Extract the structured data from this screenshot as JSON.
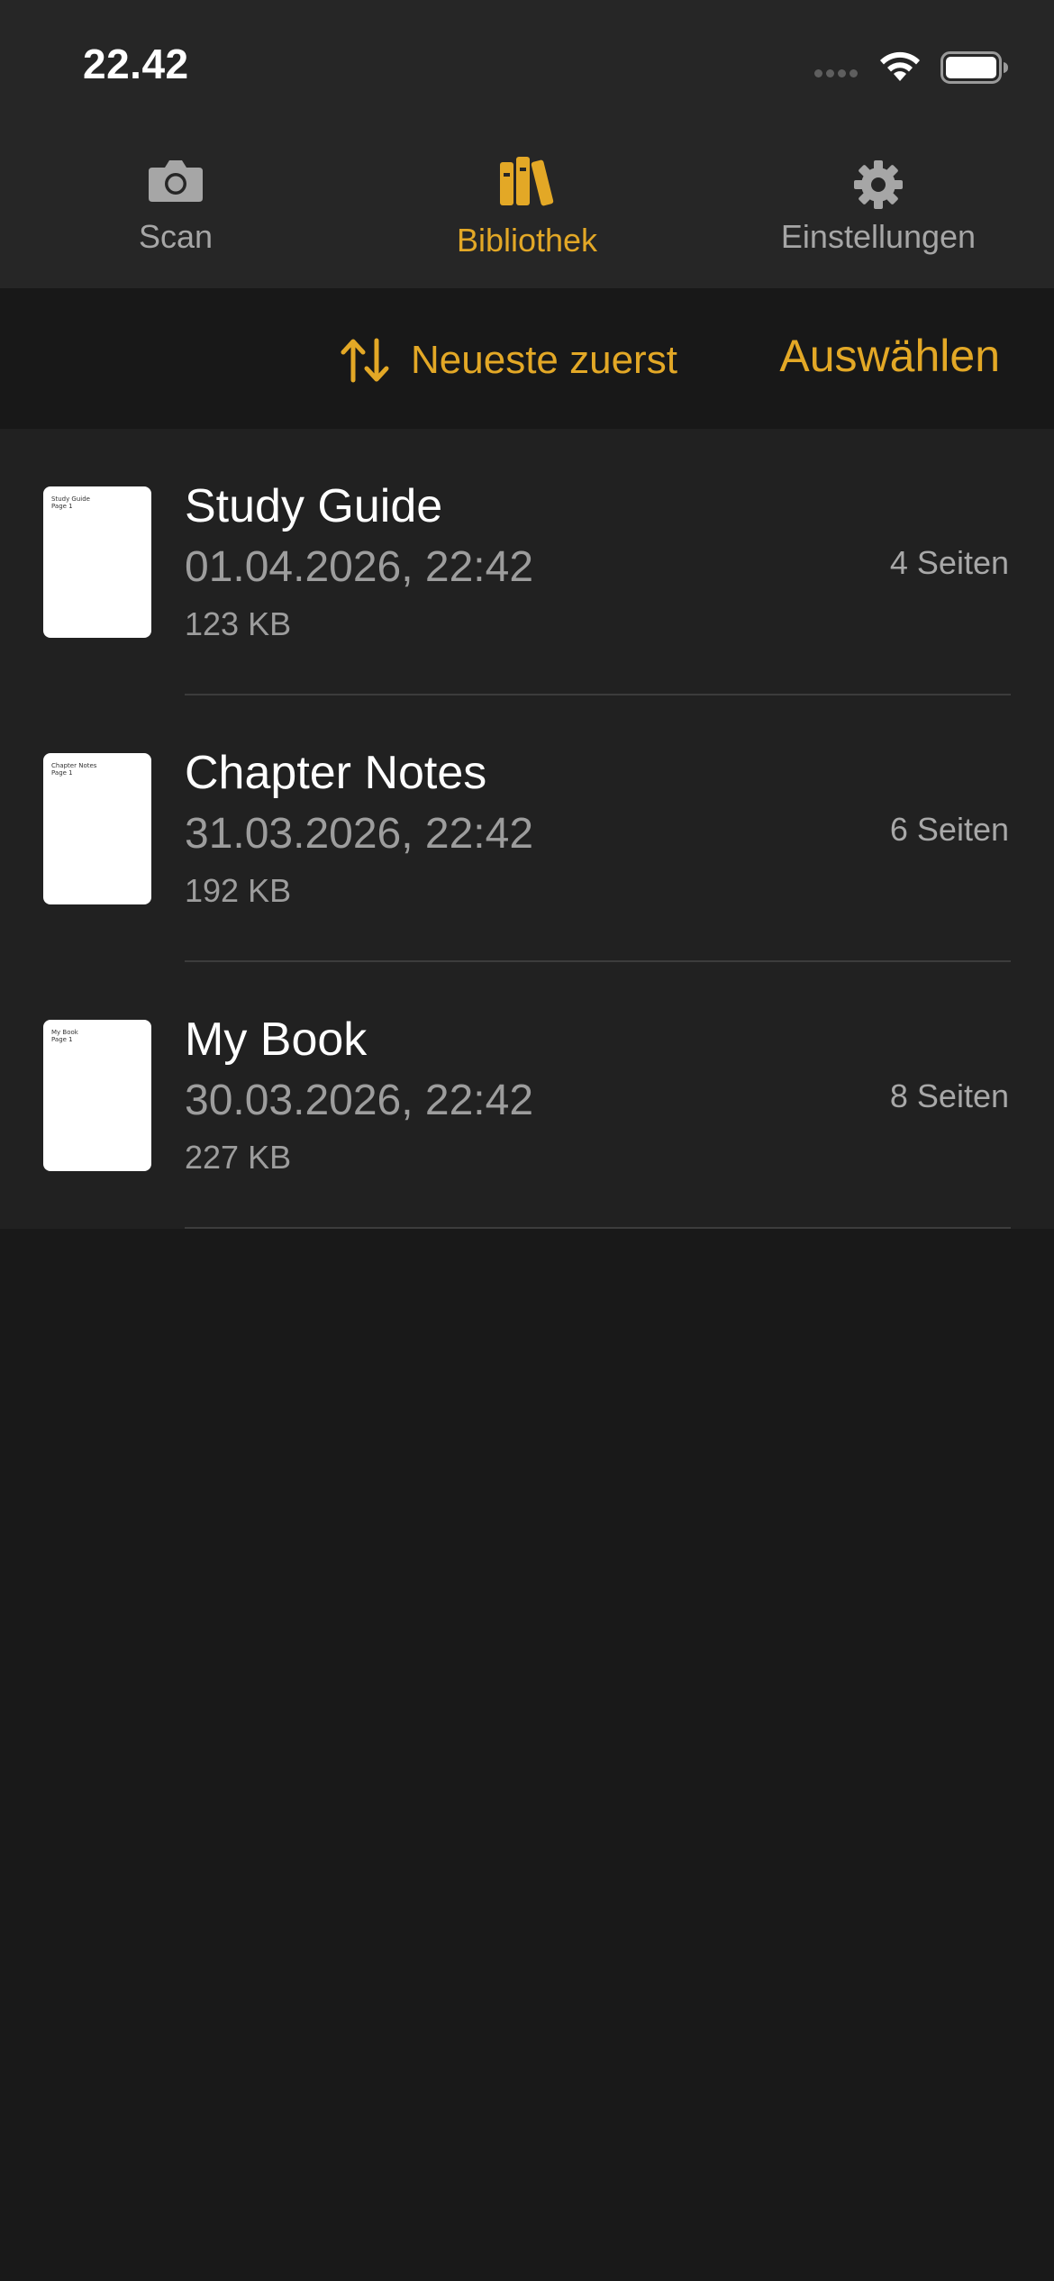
{
  "status_bar": {
    "time": "22.42"
  },
  "tabs": [
    {
      "label": "Scan",
      "icon": "camera-icon",
      "active": false
    },
    {
      "label": "Bibliothek",
      "icon": "books-icon",
      "active": true
    },
    {
      "label": "Einstellungen",
      "icon": "gear-icon",
      "active": false
    }
  ],
  "toolbar": {
    "sort_icon": "sort-arrows-icon",
    "sort_label": "Neueste zuerst",
    "select_label": "Auswählen"
  },
  "documents": [
    {
      "title": "Study Guide",
      "date": "01.04.2026, 22:42",
      "size": "123 KB",
      "pages": "4 Seiten",
      "thumb_title": "Study Guide",
      "thumb_page": "Page 1"
    },
    {
      "title": "Chapter Notes",
      "date": "31.03.2026, 22:42",
      "size": "192 KB",
      "pages": "6 Seiten",
      "thumb_title": "Chapter Notes",
      "thumb_page": "Page 1"
    },
    {
      "title": "My Book",
      "date": "30.03.2026, 22:42",
      "size": "227 KB",
      "pages": "8 Seiten",
      "thumb_title": "My Book",
      "thumb_page": "Page 1"
    }
  ],
  "colors": {
    "accent": "#e3a826",
    "background": "#191919",
    "header_background": "#262626",
    "list_background": "#212121",
    "secondary_text": "#9d9d9d"
  }
}
